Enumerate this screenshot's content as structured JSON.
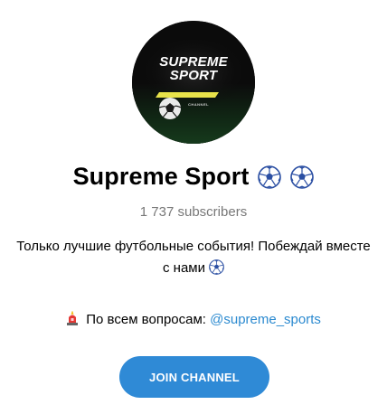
{
  "channel": {
    "avatar_logo_line1": "SUPREME",
    "avatar_logo_line2": "SPORT",
    "avatar_logo_tag": "CHANNEL",
    "title": "Supreme Sport",
    "title_icons": [
      "soccer-ball-icon",
      "soccer-ball-icon"
    ],
    "subscribers": "1 737 subscribers",
    "description": "Только лучшие футбольные события! Побеждай вместе с нами",
    "description_icon": "soccer-ball-icon",
    "contact_icon": "siren-icon",
    "contact_label": "По всем вопросам:",
    "contact_link": "@supreme_sports",
    "join_label": "JOIN CHANNEL"
  },
  "colors": {
    "accent": "#2f8ad6",
    "link": "#2b8ad0",
    "muted_text": "#787878",
    "logo_stripe": "#e8e24a"
  }
}
